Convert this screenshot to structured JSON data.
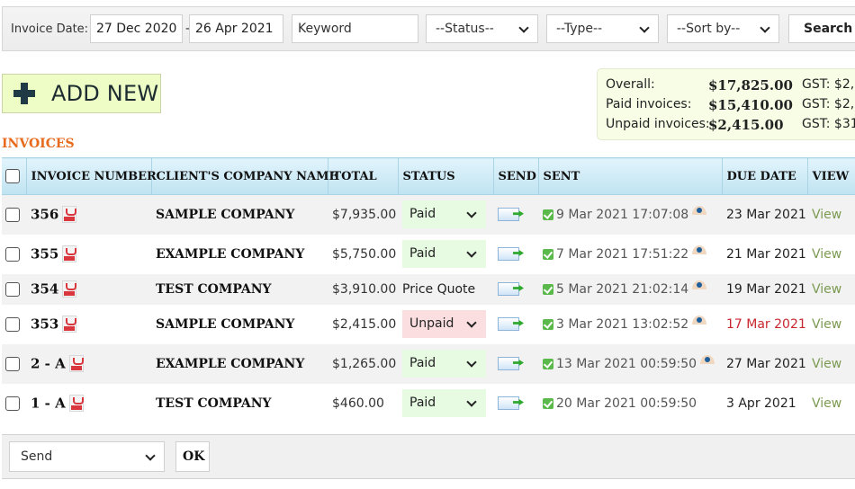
{
  "filters": {
    "invoice_date_label": "Invoice Date:",
    "date_from": "27 Dec 2020",
    "date_separator": "-",
    "date_to": "26 Apr 2021",
    "keyword_placeholder": "Keyword",
    "status_select": "--Status--",
    "type_select": "--Type--",
    "sort_select": "--Sort by--",
    "search_label": "Search"
  },
  "add_new": {
    "label": "ADD NEW",
    "icon": "plus-icon"
  },
  "summary": [
    {
      "label": "Overall:",
      "value": "$17,825.00",
      "gst": "GST: $2,"
    },
    {
      "label": "Paid invoices:",
      "value": "$15,410.00",
      "gst": "GST: $2,"
    },
    {
      "label": "Unpaid invoices:",
      "value": "$2,415.00",
      "gst": "GST: $31"
    }
  ],
  "section_title": "INVOICES",
  "table": {
    "columns": [
      "INVOICE NUMBER",
      "CLIENT'S COMPANY NAME",
      "TOTAL",
      "STATUS",
      "SEND",
      "SENT",
      "DUE DATE",
      "VIEW"
    ],
    "rows": [
      {
        "number": "356",
        "company": "SAMPLE COMPANY",
        "total": "$7,935.00",
        "status": "Paid",
        "status_type": "select-paid",
        "sent": "9 Mar 2021 17:07:08",
        "viewed": true,
        "due": "23 Mar 2021",
        "overdue": false,
        "view": "View"
      },
      {
        "number": "355",
        "company": "EXAMPLE COMPANY",
        "total": "$5,750.00",
        "status": "Paid",
        "status_type": "select-paid",
        "sent": "7 Mar 2021 17:51:22",
        "viewed": true,
        "due": "21 Mar 2021",
        "overdue": false,
        "view": "View"
      },
      {
        "number": "354",
        "company": "TEST COMPANY",
        "total": "$3,910.00",
        "status": "Price Quote",
        "status_type": "text",
        "sent": "5 Mar 2021 21:02:14",
        "viewed": true,
        "due": "19 Mar 2021",
        "overdue": false,
        "view": "View"
      },
      {
        "number": "353",
        "company": "SAMPLE COMPANY",
        "total": "$2,415.00",
        "status": "Unpaid",
        "status_type": "select-unpaid",
        "sent": "3 Mar 2021 13:02:52",
        "viewed": true,
        "due": "17 Mar 2021",
        "overdue": true,
        "view": "View"
      },
      {
        "number": "2 - A",
        "company": "EXAMPLE COMPANY",
        "total": "$1,265.00",
        "status": "Paid",
        "status_type": "select-paid",
        "sent": "13 Mar 2021 00:59:50",
        "viewed": true,
        "due": "27 Mar 2021",
        "overdue": false,
        "view": "View"
      },
      {
        "number": "1 - A",
        "company": "TEST COMPANY",
        "total": "$460.00",
        "status": "Paid",
        "status_type": "select-paid",
        "sent": "20 Mar 2021 00:59:50",
        "viewed": false,
        "due": "3 Apr 2021",
        "overdue": false,
        "view": "View"
      }
    ]
  },
  "bulk_action": {
    "selected": "Send",
    "ok_label": "OK"
  },
  "colors": {
    "accent_orange": "#e86a1c",
    "paid_bg": "#e6fbe2",
    "unpaid_bg": "#fbdfe0",
    "overdue_red": "#c8262e",
    "view_link": "#7c9a52",
    "add_new_bg": "#eefcc6"
  }
}
